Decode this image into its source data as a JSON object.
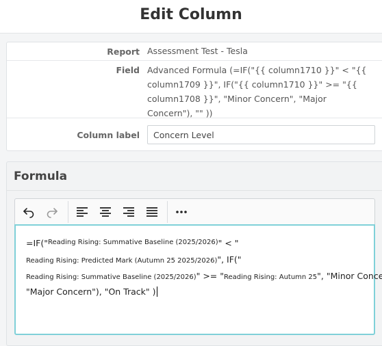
{
  "page": {
    "title": "Edit Column"
  },
  "details": {
    "report_label": "Report",
    "report_value": "Assessment Test - Tesla",
    "field_label": "Field",
    "field_value": "Advanced Formula (=IF(\"{{ column1710 }}\" < \"{{ column1709 }}\", IF(\"{{ column1710 }}\" >= \"{{ column1708 }}\", \"Minor Concern\", \"Major Concern\"), \"\" ))",
    "column_label_label": "Column label",
    "column_label_value": "Concern Level"
  },
  "formula": {
    "title": "Formula",
    "toolbar": {
      "icons": [
        "undo-icon",
        "redo-icon",
        "align-left-icon",
        "align-center-icon",
        "align-right-icon",
        "align-justify-icon",
        "more-icon"
      ]
    },
    "editor": {
      "line1": {
        "prefix": "=IF(\"",
        "token": "Reading Rising: Summative Baseline (2025/2026)",
        "suffix": "\" < \""
      },
      "line2": {
        "token": "Reading Rising: Predicted Mark (Autumn 25 2025/2026)",
        "suffix": "\", IF(\""
      },
      "line3": {
        "token1": "Reading Rising: Summative Baseline (2025/2026)",
        "mid": "\" >= \"",
        "token2": "Reading Rising: Autumn 25",
        "suffix": "\", \"Minor Concern\","
      },
      "line4": {
        "text": "\"Major Concern\"), \"On Track\" )"
      }
    }
  },
  "colors": {
    "accent": "#7fd0d8",
    "label": "#666666"
  }
}
